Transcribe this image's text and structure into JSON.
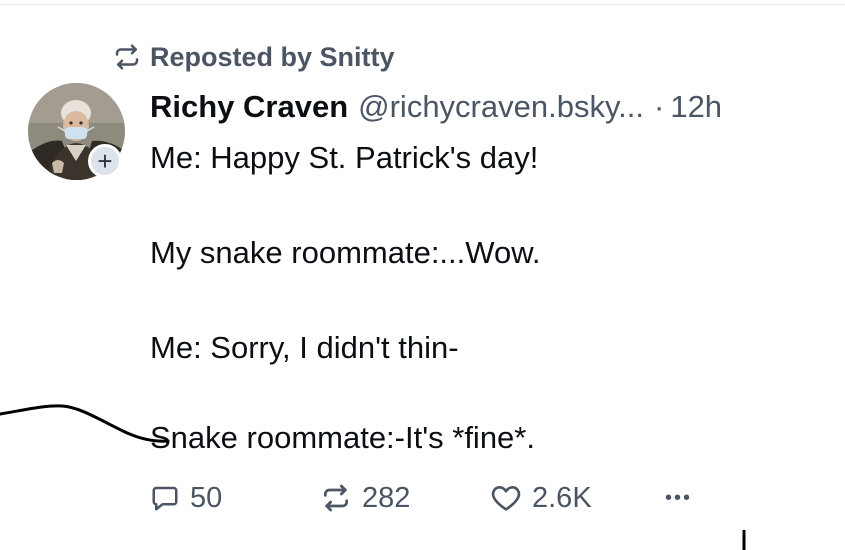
{
  "repost": {
    "text": "Reposted by Snitty",
    "icon": "repost-icon"
  },
  "author": {
    "display_name": "Richy Craven",
    "handle": "@richycraven.bsky...",
    "separator": "·",
    "time": "12h",
    "avatar_icon": "avatar-portrait",
    "follow_icon": "plus-icon",
    "follow_label": "+"
  },
  "post": {
    "lines": [
      "Me: Happy St. Patrick's day!",
      "My snake roommate:...Wow.",
      "Me: Sorry, I didn't thin-",
      "Snake roommate:-It's *fine*."
    ]
  },
  "actions": {
    "reply_count": "50",
    "repost_count": "282",
    "like_count": "2.6K",
    "more_icon": "ellipsis-icon",
    "more_label": "•••"
  },
  "colors": {
    "text_primary": "#0b0f14",
    "text_secondary": "#4b5563",
    "follow_badge": "#dde3ea",
    "divider": "#e6e9ec"
  }
}
